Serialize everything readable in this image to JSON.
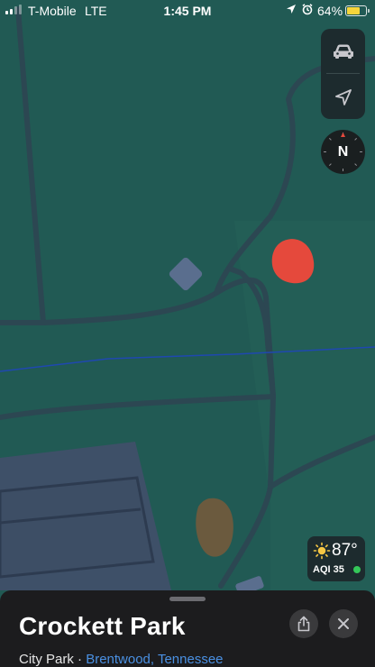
{
  "status_bar": {
    "carrier": "T-Mobile",
    "network": "LTE",
    "time": "1:45 PM",
    "battery_percent": "64%",
    "battery_level": 0.64,
    "signal_bars_active": 2,
    "icons": [
      "location-arrow-icon",
      "alarm-icon"
    ]
  },
  "map": {
    "controls": [
      "car-icon",
      "location-arrow-icon"
    ],
    "compass_letter": "N"
  },
  "weather": {
    "icon": "sun-icon",
    "temperature": "87°",
    "aqi": "AQI 35",
    "aqi_color": "#34c759"
  },
  "place_card": {
    "name": "Crockett Park",
    "type": "City Park",
    "separator": "·",
    "location": "Brentwood, Tennessee",
    "actions": [
      "share-icon",
      "close-icon"
    ]
  },
  "colors": {
    "map_green": "#215a54",
    "road": "#2c4752",
    "urban_area": "#3e5068",
    "marker_red": "#e5493c",
    "link_blue": "#4a90e2"
  }
}
